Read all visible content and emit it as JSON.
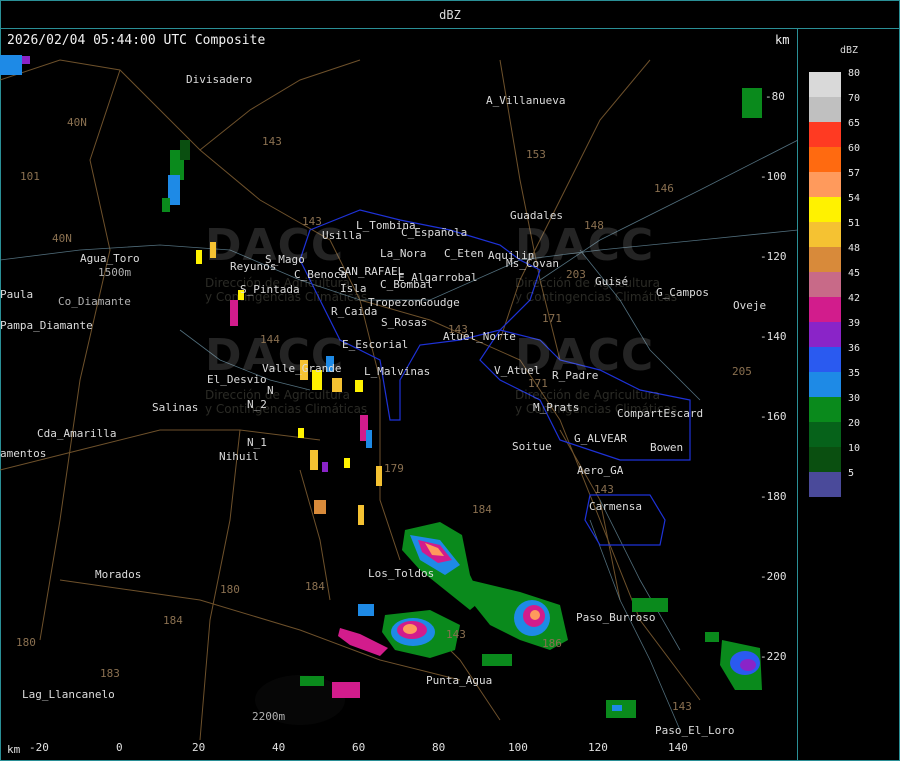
{
  "title": "dBZ",
  "header": {
    "timestamp": "2026/02/04 05:44:00 UTC Composite",
    "km_label": "km"
  },
  "legend": {
    "title": "dBZ",
    "levels": [
      {
        "value": "80",
        "color": "#d9d9d9"
      },
      {
        "value": "70",
        "color": "#c0c0c0"
      },
      {
        "value": "65",
        "color": "#ff3a22"
      },
      {
        "value": "60",
        "color": "#ff6a10"
      },
      {
        "value": "57",
        "color": "#ff9a5c"
      },
      {
        "value": "54",
        "color": "#fff200"
      },
      {
        "value": "51",
        "color": "#f5c232"
      },
      {
        "value": "48",
        "color": "#d88a3a"
      },
      {
        "value": "45",
        "color": "#c86a88"
      },
      {
        "value": "42",
        "color": "#d21c8c"
      },
      {
        "value": "39",
        "color": "#8a24c8"
      },
      {
        "value": "36",
        "color": "#2a5af0"
      },
      {
        "value": "35",
        "color": "#1e8ae6"
      },
      {
        "value": "30",
        "color": "#0a8a1c"
      },
      {
        "value": "20",
        "color": "#06621a"
      },
      {
        "value": "10",
        "color": "#0a4f10"
      },
      {
        "value": "5",
        "color": "#4a4a9a"
      }
    ]
  },
  "axes": {
    "x_unit": "km",
    "x_ticks": [
      "-20",
      "0",
      "20",
      "40",
      "60",
      "80",
      "100",
      "120",
      "140"
    ],
    "y_unit": "km",
    "y_ticks": [
      "-80",
      "-100",
      "-120",
      "-140",
      "-160",
      "-180",
      "-200",
      "-220"
    ]
  },
  "places": [
    "Divisadero",
    "A_Villanueva",
    "Guadales",
    "L_Tombina",
    "Usilla",
    "C_Española",
    "La_Nora",
    "C_Eten",
    "Aquilin",
    "Ms_Covan",
    "C_Benoca",
    "SAN_RAFAEL",
    "E_Algarrobal",
    "Guisé",
    "G_Campos",
    "Oveje",
    "Agua_Toro",
    "1500m",
    "Co_Diamante",
    "Reyunos",
    "S_Mago",
    "S_Pintada",
    "Isla",
    "C_Bombal",
    "Tropezon",
    "Goudge",
    "Paula",
    "Pampa_Diamante",
    "R_Caida",
    "S_Rosas",
    "Atuel_Norte",
    "E_Escorial",
    "Valle_Grande",
    "L_Malvinas",
    "V_Atuel",
    "R_Padre",
    "El_Desvio",
    "Salinas",
    "N_2",
    "N_1",
    "Nihuil",
    "M_Prats",
    "CompartEscard",
    "G_ALVEAR",
    "Bowen",
    "Cda_Amarilla",
    "amentos",
    "Soitue",
    "Aero_GA",
    "Carmensa",
    "Morados",
    "Los_Toldos",
    "Paso_Burroso",
    "Lag_Llancanelo",
    "Punta_Agua",
    "2200m",
    "Paso_El_Loro",
    "N"
  ],
  "route_numbers": [
    "143",
    "153",
    "146",
    "101",
    "40N",
    "40N",
    "143",
    "148",
    "203",
    "171",
    "144",
    "171",
    "143",
    "143",
    "179",
    "184",
    "184",
    "180",
    "184",
    "186",
    "183",
    "205",
    "143",
    "180",
    "143"
  ],
  "watermarks": {
    "brand": "DACC",
    "line1": "Dirección de Agricultura",
    "line2": "y Contingencias Climáticas"
  }
}
